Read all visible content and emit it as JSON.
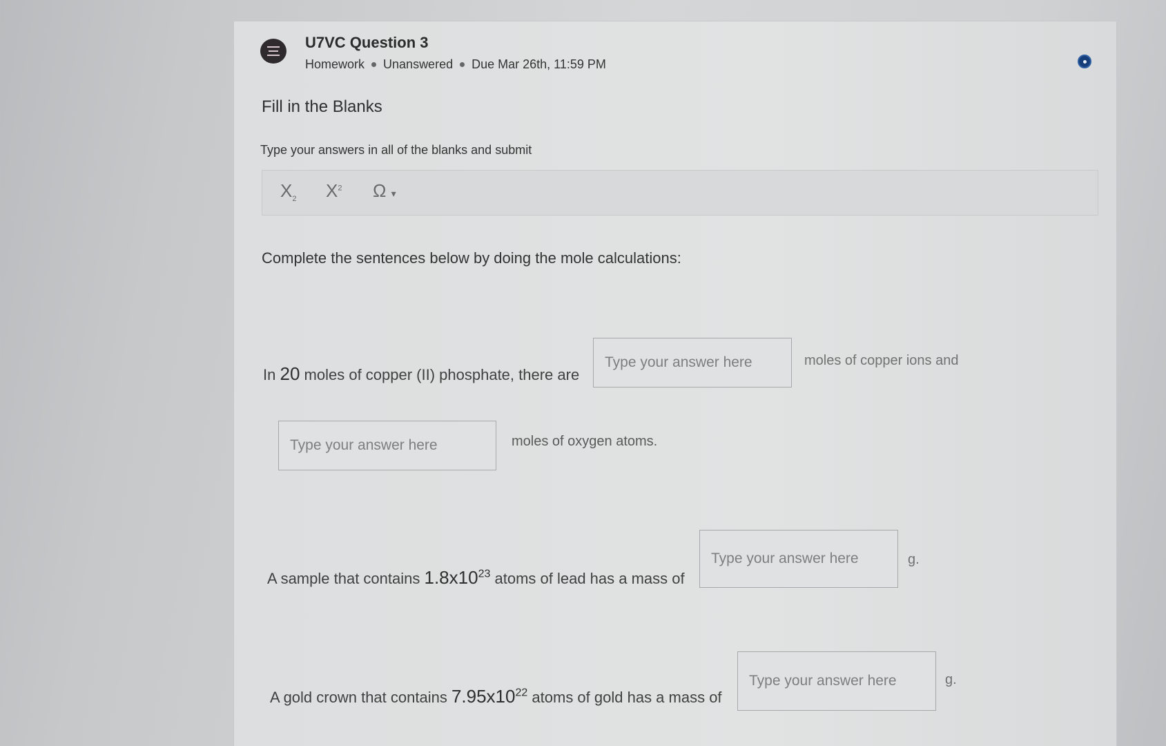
{
  "question": {
    "title": "U7VC Question 3",
    "meta": [
      "Homework",
      "Unanswered",
      "Due Mar 26th, 11:59 PM"
    ]
  },
  "section_title": "Fill in the Blanks",
  "instructions": "Type your answers in all of the blanks and submit",
  "toolbar": {
    "subscript": "X",
    "subscript_mark": "2",
    "superscript": "X",
    "superscript_mark": "2",
    "special_chars": "Ω",
    "special_chars_caret": "▾"
  },
  "prompt": "Complete the sentences below by doing the mole calculations:",
  "placeholder": "Type your answer here",
  "sentence1": {
    "pre": "In",
    "number": "20",
    "mid": "moles of copper (II) phosphate, there are",
    "post": "moles of copper ions and"
  },
  "sentence2": {
    "post": "moles of oxygen atoms."
  },
  "sentence3": {
    "pre": "A sample that contains",
    "base": "1.8x10",
    "exp": "23",
    "mid": "atoms of lead has a mass of",
    "unit": "g."
  },
  "sentence4": {
    "pre": "A gold crown that contains",
    "base": "7.95x10",
    "exp": "22",
    "mid": "atoms of gold has a mass of",
    "unit": "g."
  }
}
